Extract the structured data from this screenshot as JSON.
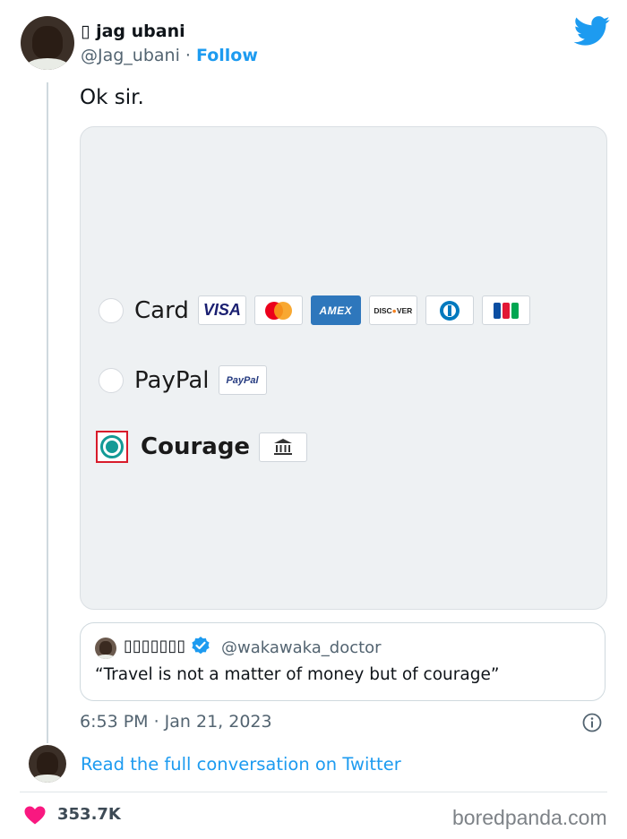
{
  "tweet": {
    "author_name": "▯ jag ubani",
    "handle": "@Jag_ubani",
    "separator": "·",
    "follow_label": "Follow",
    "text": "Ok sir.",
    "timestamp": "6:53 PM · Jan 21, 2023",
    "read_link": "Read the full conversation on Twitter",
    "likes": "353.7K"
  },
  "media": {
    "options": [
      {
        "label": "Card",
        "selected": false,
        "badges": [
          "VISA",
          "mastercard",
          "AMEX",
          "DISCOVER",
          "diners",
          "jcb"
        ]
      },
      {
        "label": "PayPal",
        "selected": false,
        "badges": [
          "PayPal"
        ]
      },
      {
        "label": "Courage",
        "selected": true,
        "badges": [
          "bank-icon"
        ]
      }
    ]
  },
  "quote": {
    "name": "▯▯▯▯▯▯▯",
    "handle": "@wakawaka_doctor",
    "text": "“Travel is not a matter of money but of courage”"
  },
  "watermark": "boredpanda.com",
  "colors": {
    "accent": "#1d9bf0",
    "heart": "#f91880",
    "selected_radio": "#139a96",
    "highlight_box": "#d81b2a"
  }
}
